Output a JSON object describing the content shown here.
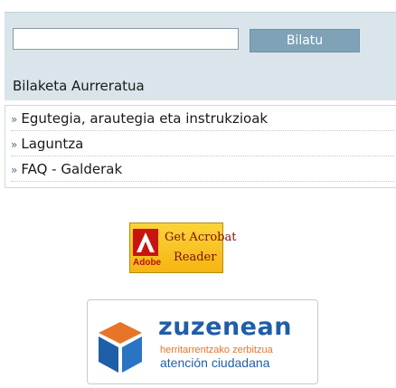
{
  "search": {
    "input_value": "",
    "button_label": "Bilatu",
    "advanced_label": "Bilaketa Aurreratua"
  },
  "links": {
    "bullet": "»",
    "items": [
      {
        "label": "Egutegia, arautegia eta instrukzioak"
      },
      {
        "label": "Laguntza"
      },
      {
        "label": "FAQ - Galderak"
      }
    ]
  },
  "acrobat_banner": {
    "line1": "Get Acrobat",
    "line2": "Reader",
    "brand": "Adobe"
  },
  "zuzenean_banner": {
    "brand": "zuzenean",
    "subtitle_eu": "herritarrentzako zerbitzua",
    "subtitle_es": "atención ciudadana"
  },
  "colors": {
    "search_panel_bg": "#d9e5ea",
    "search_button_bg": "#7fa2b6",
    "zuzenean_blue": "#1f5ea8",
    "zuzenean_orange": "#e8742a"
  },
  "icons": {
    "link_bullet": "double-chevron-right-icon",
    "acrobat_logo": "adobe-acrobat-logo-icon",
    "zuzenean_logo": "zuzenean-cube-logo-icon"
  }
}
